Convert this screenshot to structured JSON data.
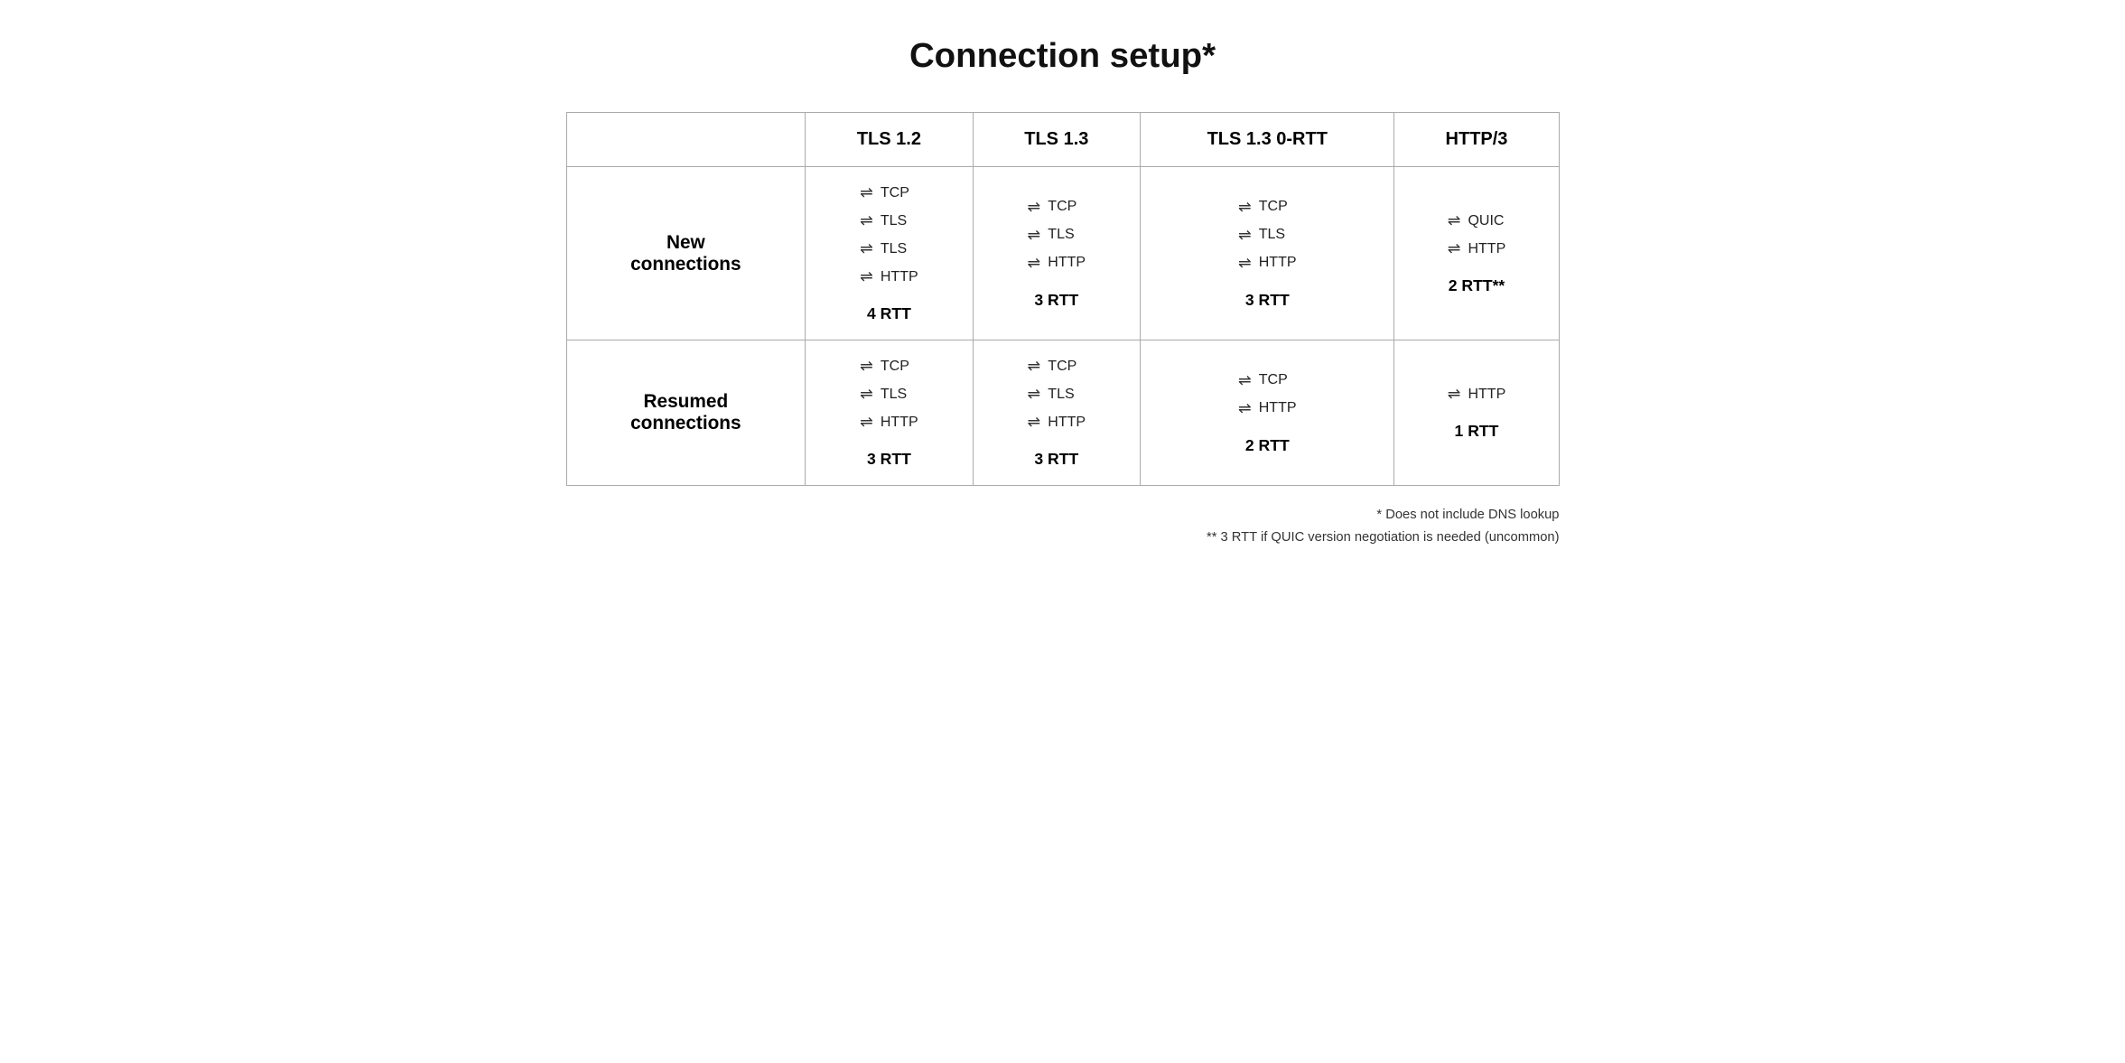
{
  "title": "Connection setup*",
  "columns": [
    "",
    "TLS 1.2",
    "TLS 1.3",
    "TLS 1.3 0-RTT",
    "HTTP/3"
  ],
  "rows": [
    {
      "label": "New\nconnections",
      "cells": [
        {
          "protocols": [
            "TCP",
            "TLS",
            "TLS",
            "HTTP"
          ],
          "rtt": "4 RTT"
        },
        {
          "protocols": [
            "TCP",
            "TLS",
            "HTTP"
          ],
          "rtt": "3 RTT"
        },
        {
          "protocols": [
            "TCP",
            "TLS",
            "HTTP"
          ],
          "rtt": "3 RTT"
        },
        {
          "protocols": [
            "QUIC",
            "HTTP"
          ],
          "rtt": "2 RTT**"
        }
      ]
    },
    {
      "label": "Resumed\nconnections",
      "cells": [
        {
          "protocols": [
            "TCP",
            "TLS",
            "HTTP"
          ],
          "rtt": "3 RTT"
        },
        {
          "protocols": [
            "TCP",
            "TLS",
            "HTTP"
          ],
          "rtt": "3 RTT"
        },
        {
          "protocols": [
            "TCP",
            "HTTP"
          ],
          "rtt": "2 RTT"
        },
        {
          "protocols": [
            "HTTP"
          ],
          "rtt": "1 RTT"
        }
      ]
    }
  ],
  "footnotes": [
    "* Does not include DNS lookup",
    "** 3 RTT if QUIC version negotiation is needed (uncommon)"
  ]
}
